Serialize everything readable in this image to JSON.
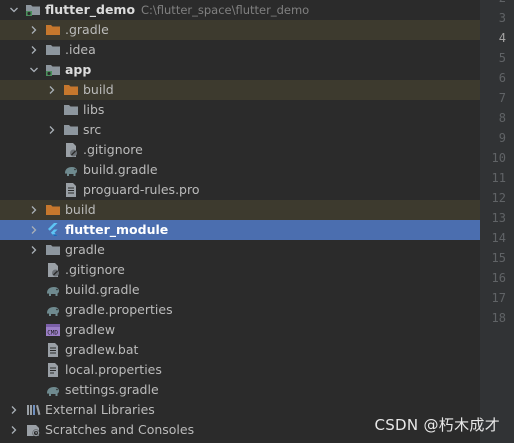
{
  "tree": [
    {
      "label": "flutter_demo",
      "path": "C:\\flutter_space\\flutter_demo",
      "icon": "module-folder-icon",
      "arrow": "down",
      "bold": true
    },
    {
      "label": ".gradle",
      "icon": "folder-orange-icon",
      "arrow": "right",
      "bg": "excluded"
    },
    {
      "label": ".idea",
      "icon": "folder-icon",
      "arrow": "right"
    },
    {
      "label": "app",
      "icon": "module-folder-icon",
      "arrow": "down",
      "bold": true
    },
    {
      "label": "build",
      "icon": "folder-orange-icon",
      "arrow": "right",
      "bg": "excluded"
    },
    {
      "label": "libs",
      "icon": "folder-icon"
    },
    {
      "label": "src",
      "icon": "folder-icon",
      "arrow": "right"
    },
    {
      "label": ".gitignore",
      "icon": "gitignore-file-icon"
    },
    {
      "label": "build.gradle",
      "icon": "gradle-elephant-icon"
    },
    {
      "label": "proguard-rules.pro",
      "icon": "text-file-icon"
    },
    {
      "label": "build",
      "icon": "folder-orange-icon",
      "arrow": "right",
      "bg": "excluded"
    },
    {
      "label": "flutter_module",
      "icon": "flutter-icon",
      "arrow": "right",
      "bg": "selected"
    },
    {
      "label": "gradle",
      "icon": "folder-icon",
      "arrow": "right"
    },
    {
      "label": ".gitignore",
      "icon": "gitignore-file-icon"
    },
    {
      "label": "build.gradle",
      "icon": "gradle-elephant-icon"
    },
    {
      "label": "gradle.properties",
      "icon": "gradle-elephant-icon"
    },
    {
      "label": "gradlew",
      "icon": "shell-script-icon"
    },
    {
      "label": "gradlew.bat",
      "icon": "text-file-icon"
    },
    {
      "label": "local.properties",
      "icon": "properties-file-icon"
    },
    {
      "label": "settings.gradle",
      "icon": "gradle-elephant-icon"
    },
    {
      "label": "External Libraries",
      "icon": "libraries-icon",
      "arrow": "right"
    },
    {
      "label": "Scratches and Consoles",
      "icon": "scratches-icon",
      "arrow": "right"
    }
  ],
  "gutter": {
    "lines": [
      "2",
      "3",
      "4",
      "5",
      "6",
      "7",
      "8",
      "9",
      "10",
      "11",
      "12",
      "13",
      "14",
      "15",
      "16",
      "17",
      "18"
    ],
    "current": "4"
  },
  "watermark": "CSDN @朽木成才",
  "colors": {
    "background": "#2b2b2b",
    "selection": "#4b6eaf",
    "excluded": "#3d3a2e",
    "folder": "#8d969e",
    "folder_excluded": "#c6772d"
  }
}
